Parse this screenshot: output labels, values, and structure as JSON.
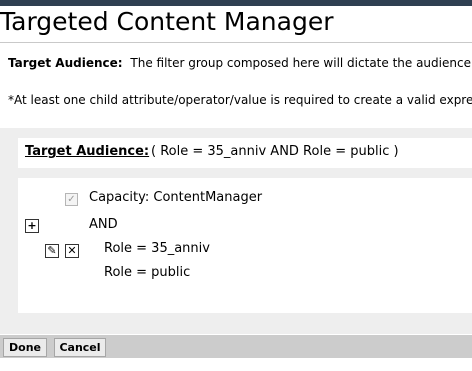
{
  "page": {
    "title": "Targeted Content Manager"
  },
  "intro": {
    "label": "Target Audience:",
    "text": "The filter group composed here will dictate the audience f",
    "note": "*At least one child attribute/operator/value is required to create a valid expres"
  },
  "audience": {
    "label": "Target Audience:",
    "expression": "( Role = 35_anniv AND Role = public )"
  },
  "tree": {
    "capacity_checked": true,
    "capacity_text": "Capacity:  ContentManager",
    "operator": "AND",
    "conditions": [
      "Role = 35_anniv",
      "Role = public"
    ]
  },
  "buttons": {
    "done": "Done",
    "cancel": "Cancel"
  },
  "colors": {
    "topbar": "#2f3f51",
    "panel": "#eeeeee",
    "button_bar": "#cccccc"
  },
  "icons": {
    "add": "plus-icon",
    "edit": "pencil-icon",
    "delete": "x-icon",
    "check": "checkmark-icon"
  }
}
